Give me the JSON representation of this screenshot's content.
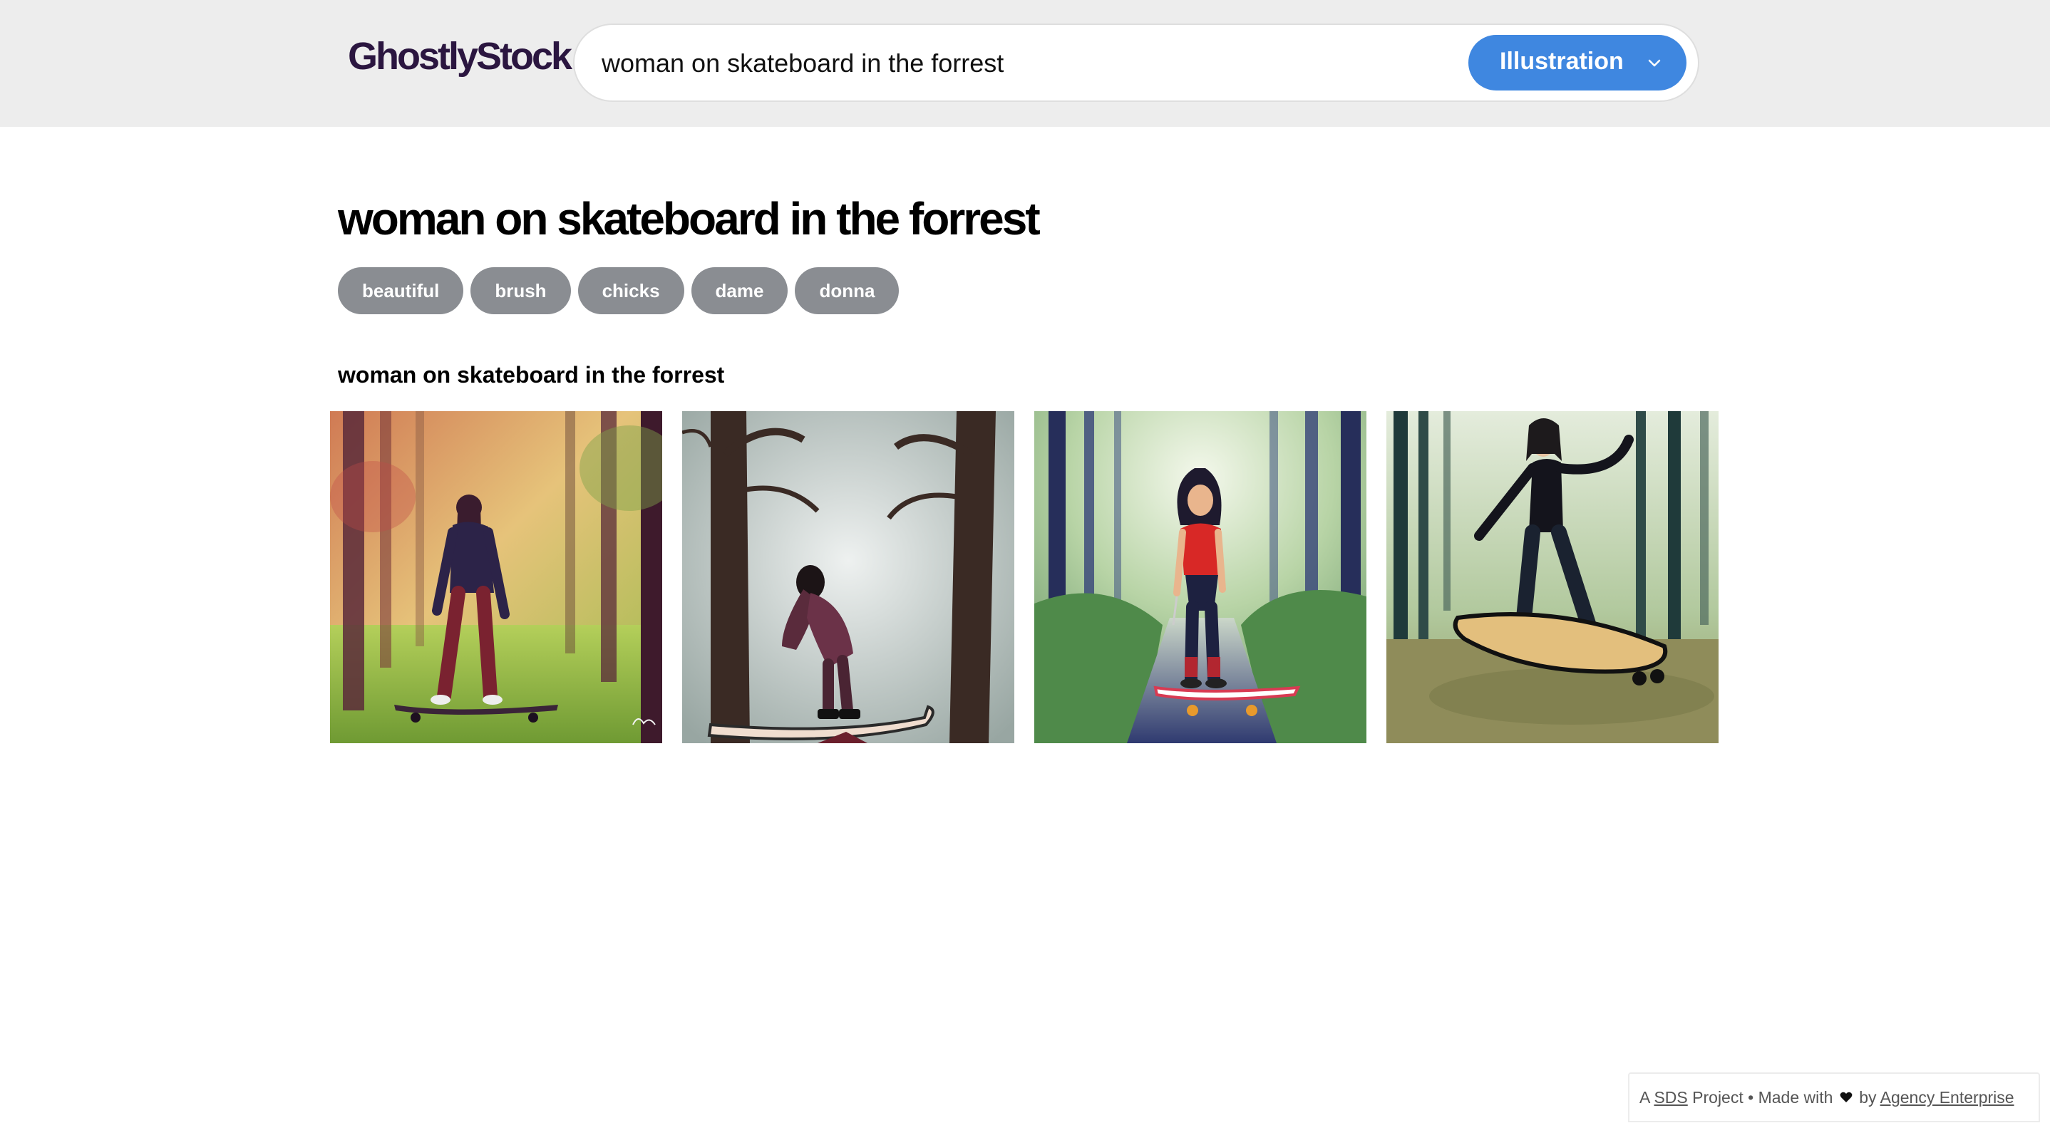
{
  "header": {
    "logo": "GhostlyStock",
    "search": {
      "value": "woman on skateboard in the forrest",
      "placeholder": ""
    },
    "type_select": {
      "label": "Illustration",
      "icon": "chevron-down-icon"
    }
  },
  "main": {
    "title": "woman on skateboard in the forrest",
    "tags": [
      {
        "label": "beautiful"
      },
      {
        "label": "brush"
      },
      {
        "label": "chicks"
      },
      {
        "label": "dame"
      },
      {
        "label": "donna"
      }
    ],
    "section_title": "woman on skateboard in the forrest"
  },
  "footer": {
    "prefix": "A",
    "sds_link": "SDS",
    "project_text": "Project • Made with",
    "heart_icon": "heart-icon",
    "by_text": "by",
    "agency_link": "Agency Enterprise"
  },
  "colors": {
    "header_bg": "#ededed",
    "logo": "#2b1640",
    "accent": "#3f87e0",
    "tag_bg": "#8a8d92"
  }
}
